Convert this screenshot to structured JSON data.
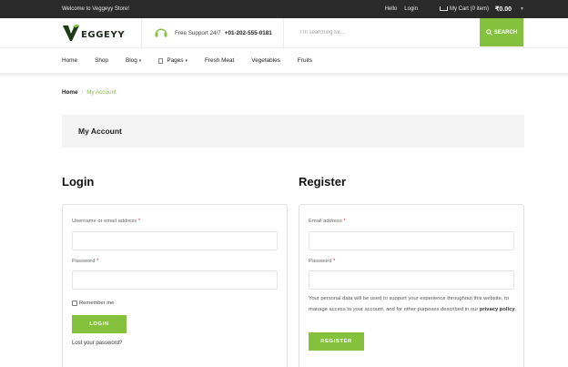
{
  "topbar": {
    "welcome": "Welcome to Veggeyy Store!",
    "hello": "Hello",
    "login": "Login",
    "cart_label": "My Cart (0 item)",
    "cart_total": "₹0.00"
  },
  "header": {
    "logo_text": "EGGEYY",
    "support_label": "Free Support 24/7",
    "support_phone": "+01-202-555-0181",
    "search_placeholder": "I'm searching for...",
    "search_button": "SEARCH",
    "brand_color": "#84c23e"
  },
  "nav": {
    "items": [
      {
        "label": "Home"
      },
      {
        "label": "Shop"
      },
      {
        "label": "Blog"
      },
      {
        "label": "Pages"
      },
      {
        "label": "Fresh Meat"
      },
      {
        "label": "Vegetables"
      },
      {
        "label": "Fruits"
      }
    ]
  },
  "breadcrumb": {
    "home": "Home",
    "separator": "/",
    "current": "My Account"
  },
  "page_title": "My Account",
  "login": {
    "heading": "Login",
    "username_label": "Username or email address",
    "password_label": "Password",
    "required_mark": "*",
    "remember_label": "Remember me",
    "button": "LOGIN",
    "lost_password": "Lost your password?"
  },
  "register": {
    "heading": "Register",
    "email_label": "Email address",
    "password_label": "Password",
    "required_mark": "*",
    "privacy_text": "Your personal data will be used to support your experience throughout this website, to manage access to your account, and for other purposes described in our",
    "privacy_link": "privacy policy",
    "privacy_end": ".",
    "button": "REGISTER"
  }
}
